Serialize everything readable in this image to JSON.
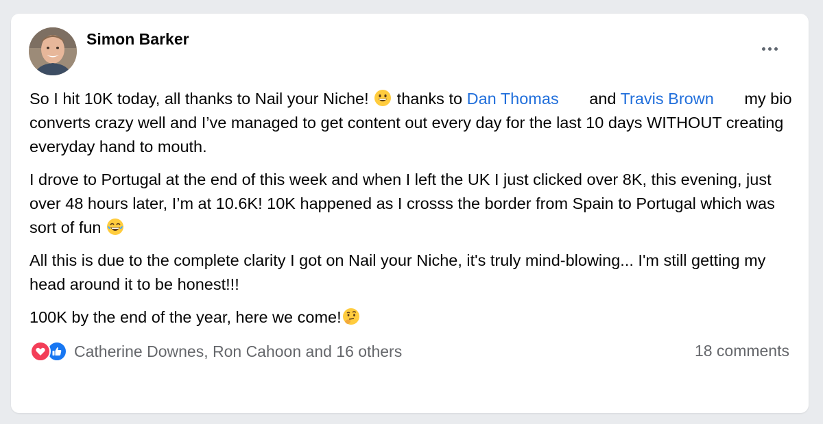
{
  "post": {
    "author": "Simon Barker",
    "paragraph1": {
      "text1": "So I hit 10K today, all thanks to Nail your Niche! ",
      "text2": " thanks to ",
      "mention1": "Dan Thomas",
      "text3": " and ",
      "mention2": "Travis Brown",
      "text4": " my bio converts crazy well and I’ve managed to get content out every day for the last 10 days WITHOUT creating everyday hand to mouth."
    },
    "paragraph2": {
      "text1": "I drove to Portugal at the end of this week and when I left the UK I just clicked over 8K, this evening, just over 48 hours later, I’m at 10.6K! 10K happened as I crosss the border from Spain to Portugal which was sort of fun "
    },
    "paragraph3": {
      "text1": "All this is due to the complete clarity I got on Nail your Niche, it's truly mind-blowing... I'm still getting my head around it to be honest!!!"
    },
    "paragraph4": {
      "text1": "100K by the end of the year, here we come!"
    },
    "emojis": {
      "grinning": "grinning-face-emoji",
      "laughing": "tears-of-joy-emoji",
      "thinking": "thinking-face-emoji"
    }
  },
  "reactions": {
    "icons": [
      "love-reaction-icon",
      "like-reaction-icon"
    ],
    "summary": "Catherine Downes, Ron Cahoon and 16 others"
  },
  "comments": {
    "label": "18 comments"
  },
  "colors": {
    "link": "#216fdb",
    "love": "#f33e58",
    "like": "#1877f2",
    "muted": "#65676b"
  }
}
